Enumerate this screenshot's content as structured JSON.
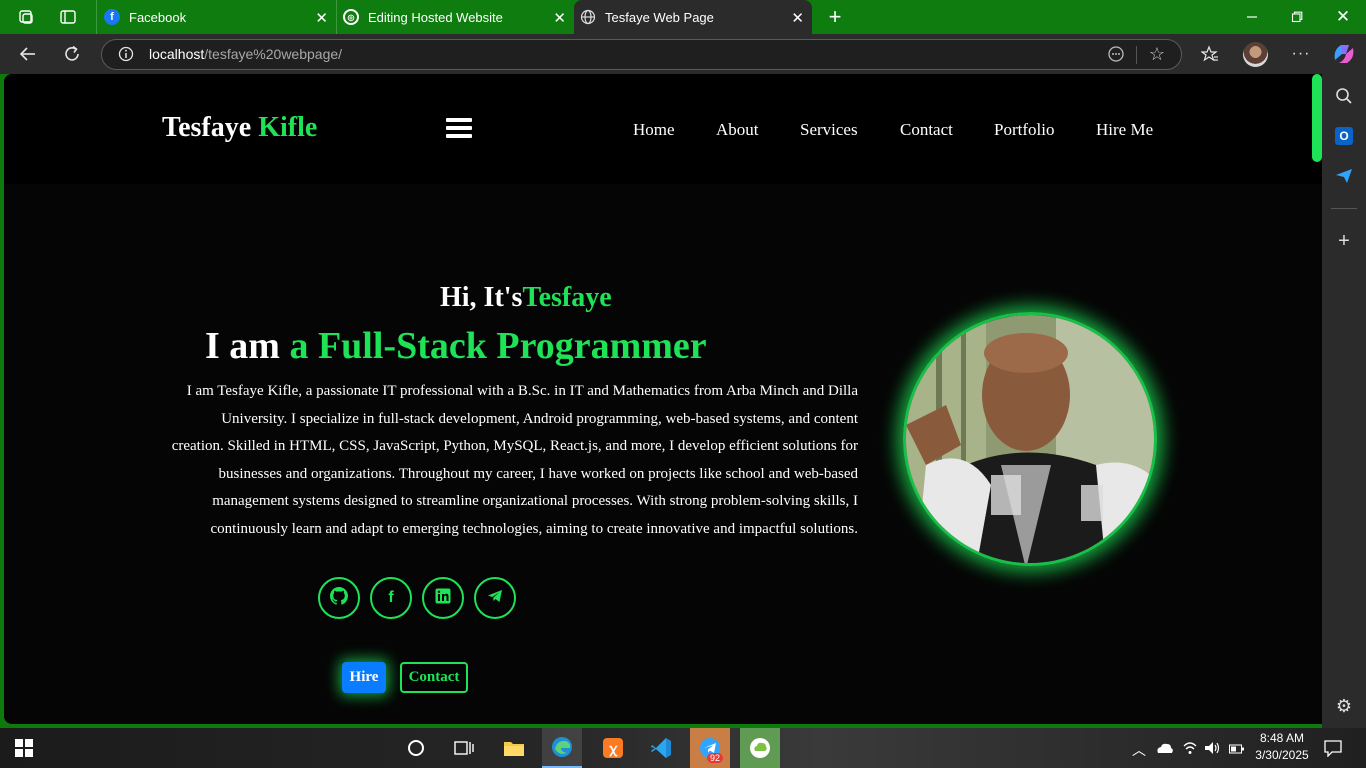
{
  "browser": {
    "tabs": [
      {
        "label": "Facebook"
      },
      {
        "label": "Editing Hosted Website"
      },
      {
        "label": "Tesfaye Web Page"
      }
    ],
    "url_host": "localhost",
    "url_path": "/tesfaye%20webpage/"
  },
  "site": {
    "logo_first": "Tesfaye",
    "logo_second": "Kifle",
    "nav": [
      "Home",
      "About",
      "Services",
      "Contact",
      "Portfolio",
      "Hire Me"
    ],
    "greeting_prefix": "Hi, It's",
    "greeting_name": "Tesfaye",
    "role_prefix": "I am",
    "role_title": "a Full-Stack Programmer",
    "bio": "I am Tesfaye Kifle, a passionate IT professional with a B.Sc. in IT and Mathematics from Arba Minch and Dilla University. I specialize in full-stack development, Android programming, web-based systems, and content creation. Skilled in HTML, CSS, JavaScript, Python, MySQL, React.js, and more, I develop efficient solutions for businesses and organizations. Throughout my career, I have worked on projects like school and web-based management systems designed to streamline organizational processes. With strong problem-solving skills, I continuously learn and adapt to emerging technologies, aiming to create innovative and impactful solutions.",
    "socials": [
      "github-icon",
      "facebook-icon",
      "linkedin-icon",
      "telegram-icon"
    ],
    "hire_label": "Hire",
    "contact_label": "Contact"
  },
  "taskbar": {
    "time": "8:48 AM",
    "date": "3/30/2025",
    "telegram_badge": "92"
  },
  "colors": {
    "accent": "#1ee356",
    "hire_button": "#0a7cff",
    "tabstrip": "#0f7c10",
    "page_bg": "#050505"
  }
}
